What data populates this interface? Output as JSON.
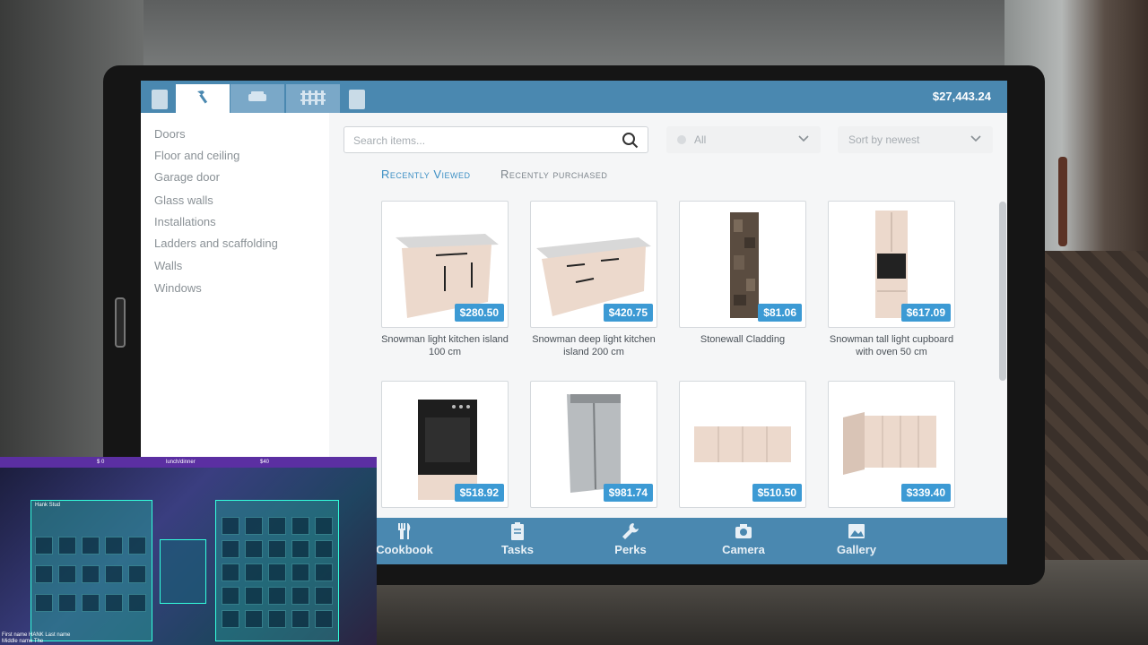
{
  "balance": "$27,443.24",
  "tabs": [
    {
      "icon": "hammer-icon",
      "active": true
    },
    {
      "icon": "sofa-icon",
      "active": false
    },
    {
      "icon": "fence-icon",
      "active": false
    }
  ],
  "categories": [
    "Doors",
    "Floor and ceiling",
    "Garage door",
    "Glass walls",
    "Installations",
    "Ladders and scaffolding",
    "Walls",
    "Windows"
  ],
  "search": {
    "placeholder": "Search items..."
  },
  "filter": {
    "value": "All"
  },
  "sort": {
    "value": "Sort by newest"
  },
  "subtabs": {
    "recently_viewed": "Recently Viewed",
    "recently_purchased": "Recently purchased"
  },
  "items": [
    {
      "name": "Snowman light kitchen island 100 cm",
      "price": "$280.50"
    },
    {
      "name": "Snowman deep light kitchen island 200 cm",
      "price": "$420.75"
    },
    {
      "name": "Stonewall Cladding",
      "price": "$81.06"
    },
    {
      "name": "Snowman tall light cupboard with oven 50 cm",
      "price": "$617.09"
    },
    {
      "name": "",
      "price": "$518.92"
    },
    {
      "name": "",
      "price": "$981.74"
    },
    {
      "name": "",
      "price": "$510.50"
    },
    {
      "name": "",
      "price": "$339.40"
    }
  ],
  "bottom_nav": [
    {
      "label": "Cookbook",
      "icon": "utensils-icon"
    },
    {
      "label": "Tasks",
      "icon": "clipboard-icon"
    },
    {
      "label": "Perks",
      "icon": "wrench-icon"
    },
    {
      "label": "Camera",
      "icon": "camera-icon"
    },
    {
      "label": "Gallery",
      "icon": "image-icon"
    }
  ],
  "overlay": {
    "top_left": "$ 0",
    "top_center": "lunch/dinner",
    "top_right": "$40",
    "panel_title": "Hank Stud",
    "footer_line1": "First name HANK Last name",
    "footer_line2": "Middle name The"
  },
  "colors": {
    "accent": "#4a88b0",
    "price_badge": "#3c9ad4"
  }
}
